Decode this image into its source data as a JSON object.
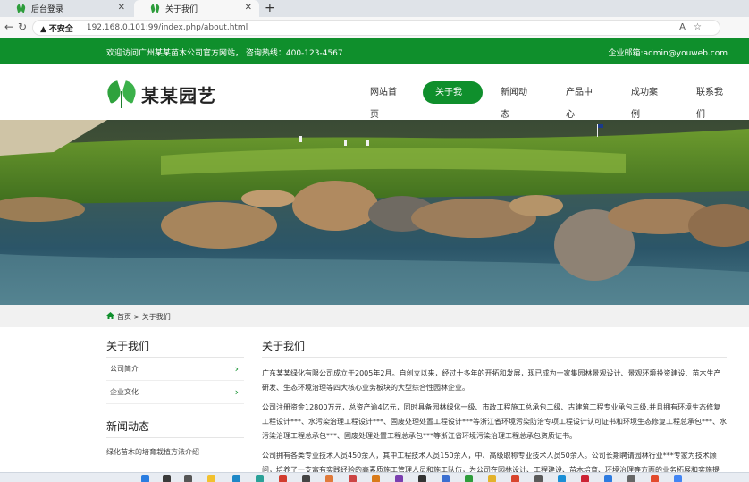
{
  "browser": {
    "tabs": [
      {
        "title": "后台登录",
        "close": "✕"
      },
      {
        "title": "关于我们",
        "close": "✕"
      }
    ],
    "new_tab": "+",
    "security_label": "不安全",
    "url": "192.168.0.101:99/index.php/about.html"
  },
  "topbar": {
    "welcome": "欢迎访问广州某某苗木公司官方网站，  咨询热线：400-123-4567",
    "email": "企业邮箱:admin@youweb.com"
  },
  "header": {
    "logo_text": "某某园艺",
    "nav": [
      "网站首页",
      "关于我们",
      "新闻动态",
      "产品中心",
      "成功案例",
      "联系我们"
    ]
  },
  "breadcrumb": "首页 > 关于我们",
  "sidebar": {
    "title": "关于我们",
    "items": [
      "公司简介",
      "企业文化"
    ],
    "news_title": "新闻动态",
    "news": [
      "绿化苗木的培育栽植方法介绍"
    ]
  },
  "content": {
    "title": "关于我们",
    "paragraphs": [
      "广东某某绿化有限公司成立于2005年2月。自创立以来，经过十多年的开拓和发展，现已成为一家集园林景观设计、景观环境投资建设、苗木生产研发、生态环境治理等四大核心业务板块的大型综合性园林企业。",
      "公司注册资金12800万元，总资产逾4亿元，同时具备园林绿化一级、市政工程施工总承包二级、古建筑工程专业承包三级,并且拥有环境生态修复工程设计***、水污染治理工程设计***、固废处理处置工程设计***等浙江省环境污染防治专项工程设计认可证书和环境生态修复工程总承包***、水污染治理工程总承包***、固废处理处置工程总承包***等浙江省环境污染治理工程总承包资质证书。",
      "公司拥有各类专业技术人员450余人，其中工程技术人员150余人，中、高级职称专业技术人员50余人。公司长期聘请园林行业***专家为技术顾问，培养了一支富有实践经验的高素质施工管理人员和施工队伍，为公司在园林设计、工程建设、苗木培育、环境治理等方面的业务拓展和实施提"
    ]
  },
  "colors": {
    "brand_green": "#0f8f2c"
  }
}
